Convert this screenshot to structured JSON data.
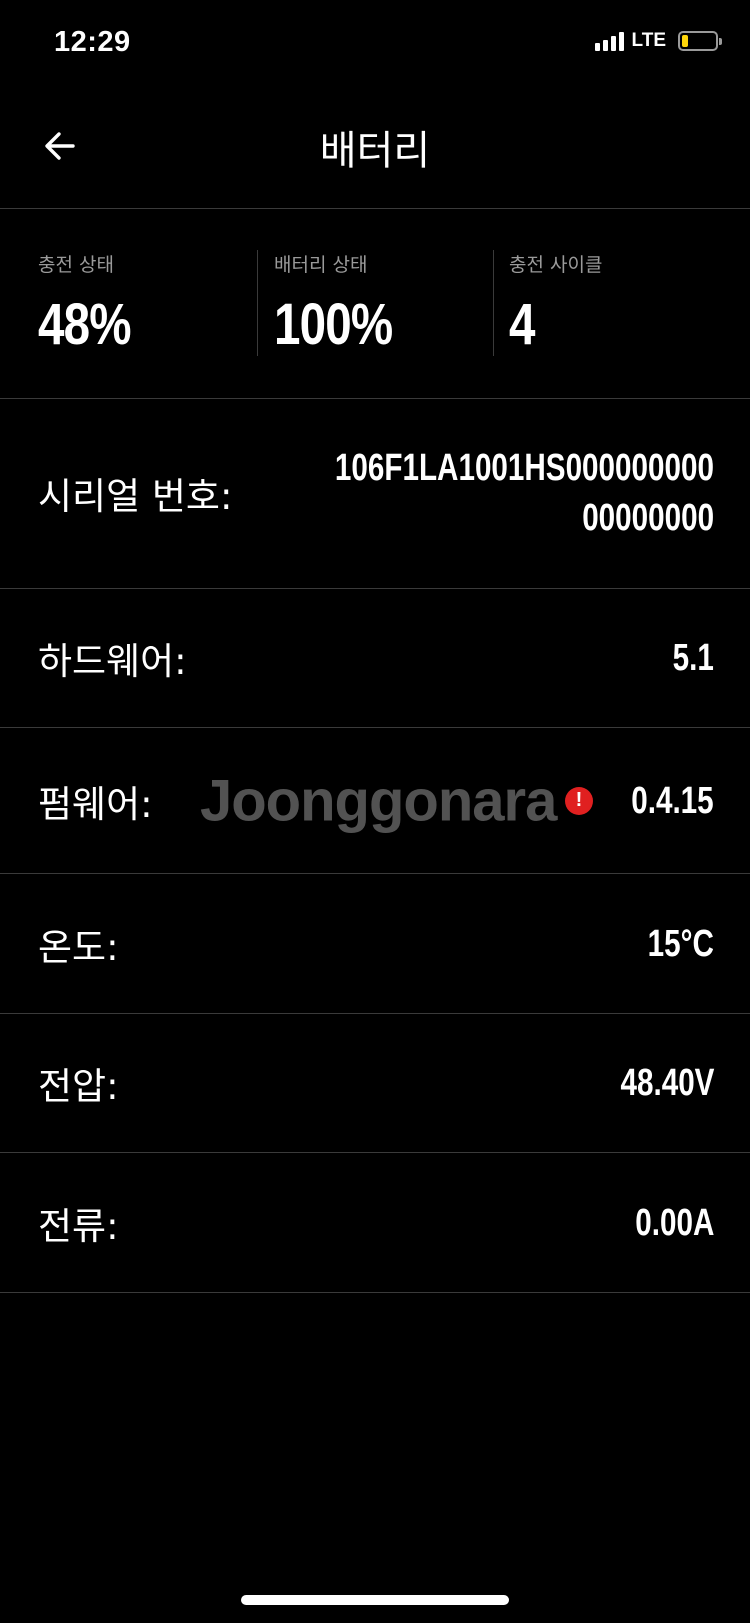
{
  "status_bar": {
    "time": "12:29",
    "network": "LTE",
    "battery_level": 0.2
  },
  "header": {
    "title": "배터리",
    "back_icon": "arrow-left-icon"
  },
  "stats": [
    {
      "label": "충전 상태",
      "value": "48%"
    },
    {
      "label": "배터리 상태",
      "value": "100%"
    },
    {
      "label": "충전 사이클",
      "value": "4"
    }
  ],
  "info": {
    "serial": {
      "label": "시리얼 번호:",
      "value_line1": "106F1LA1001HS000000000",
      "value_line2": "00000000"
    },
    "hardware": {
      "label": "하드웨어:",
      "value": "5.1"
    },
    "firmware": {
      "label": "펌웨어:",
      "value": "0.4.15",
      "alert_icon": "exclamation-icon",
      "alert_color": "#e02020"
    },
    "temperature": {
      "label": "온도:",
      "value": "15°C"
    },
    "voltage": {
      "label": "전압:",
      "value": "48.40V"
    },
    "current": {
      "label": "전류:",
      "value": "0.00A"
    }
  },
  "watermark": {
    "text": "Joonggonara"
  }
}
